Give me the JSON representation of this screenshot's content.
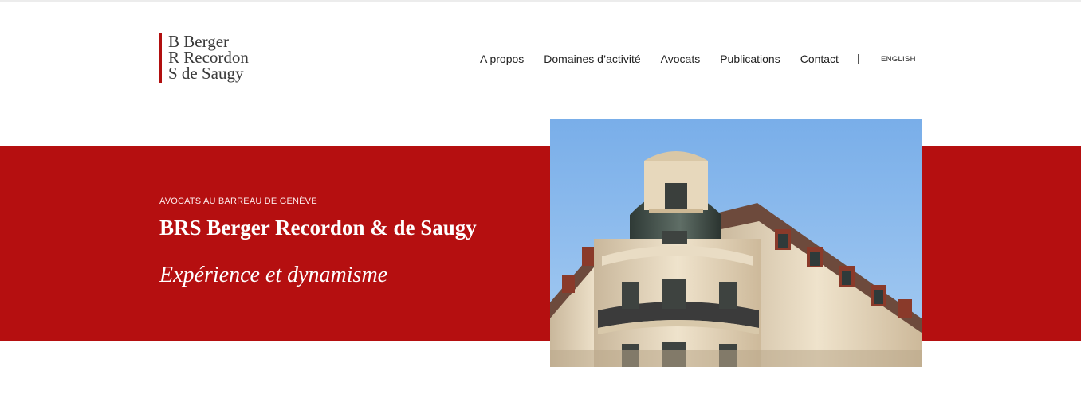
{
  "logo": {
    "line1": "B Berger",
    "line2": "R Recordon",
    "line3": "S de Saugy"
  },
  "nav": {
    "items": [
      "A propos",
      "Domaines d’activité",
      "Avocats",
      "Publications",
      "Contact"
    ],
    "language": "ENGLISH"
  },
  "hero": {
    "eyebrow": "AVOCATS AU BARREAU DE GENÈVE",
    "title": "BRS Berger Recordon & de Saugy",
    "tagline": "Expérience et dynamisme"
  },
  "colors": {
    "brand_red": "#b50f10",
    "logo_red": "#b10f0f",
    "sky_blue": "#7fb0ea",
    "text_dark": "#222222"
  },
  "icons": {
    "nav_separator": "vertical-bar"
  }
}
